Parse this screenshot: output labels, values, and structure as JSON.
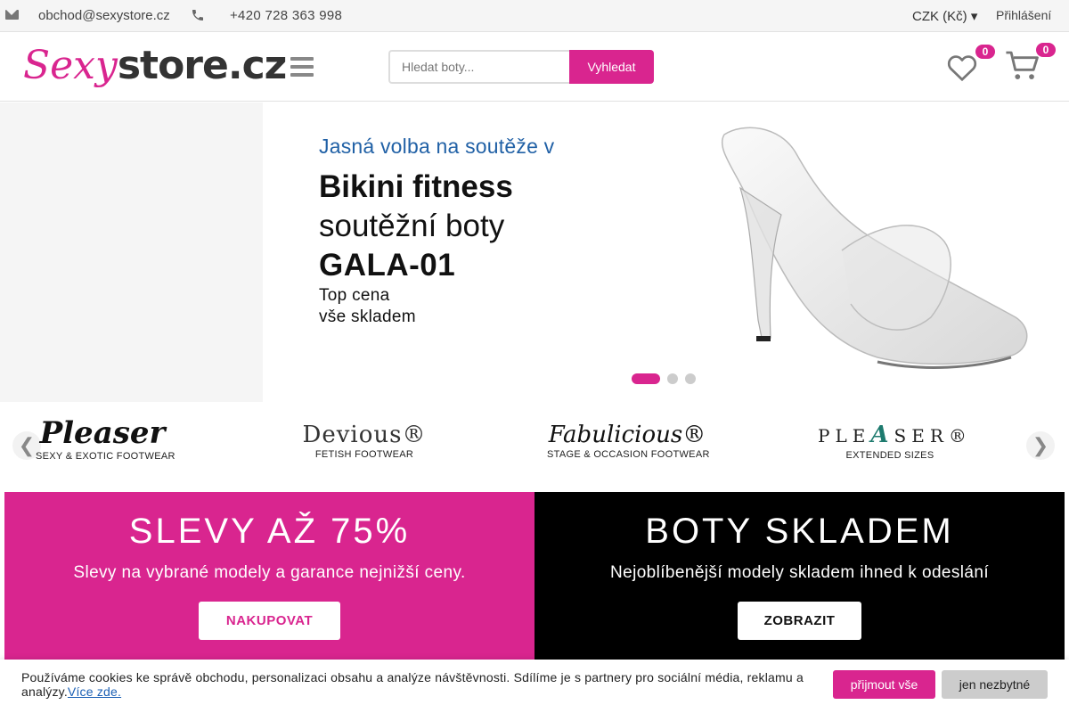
{
  "topbar": {
    "email": "obchod@sexystore.cz",
    "phone": "+420 728 363 998",
    "currency": "CZK (Kč) ▾",
    "login": " Přihlášení",
    "icons": {
      "email": "mail-icon",
      "phone": "phone-icon"
    }
  },
  "header": {
    "logo_part1": "Sexy",
    "logo_part2": "store.cz",
    "search_placeholder": "Hledat boty...",
    "search_button": "Vyhledat",
    "wishlist_count": "0",
    "cart_count": "0",
    "icons": {
      "menu": "hamburger-icon",
      "wishlist": "heart-icon",
      "cart": "cart-icon"
    }
  },
  "hero": {
    "kicker": "Jasná volba na soutěže v",
    "title": "Bikini fitness",
    "subtitle": "soutěžní boty",
    "model": "GALA-01",
    "price_line": "Top cena",
    "stock_line": "vše skladem",
    "slides": 3,
    "active_slide": 1
  },
  "brands": {
    "prev": "❮",
    "next": "❯",
    "items": [
      {
        "name": "Pleaser",
        "tagline": "SEXY & EXOTIC FOOTWEAR"
      },
      {
        "name": "Devious®",
        "tagline": "FETISH FOOTWEAR"
      },
      {
        "name": "Fabulicious®",
        "tagline": "STAGE & OCCASION FOOTWEAR"
      },
      {
        "name_a": "PLE",
        "name_b": "A",
        "name_c": "SER®",
        "tagline": "EXTENDED SIZES"
      }
    ]
  },
  "promos": {
    "sale": {
      "title": "SLEVY AŽ 75%",
      "text": "Slevy na vybrané modely a garance nejnižší ceny.",
      "button": "NAKUPOVAT"
    },
    "stock": {
      "title": "BOTY SKLADEM",
      "text": "Nejoblíbenější modely skladem ihned k odeslání",
      "button": "ZOBRAZIT"
    }
  },
  "cookie": {
    "text": "Používáme cookies ke správě obchodu, personalizaci obsahu a analýze návštěvnosti. Sdílíme je s partnery pro sociální média, reklamu a analýzy.",
    "more": "Více zde.",
    "accept": "přijmout vše",
    "essential": "jen nezbytné"
  },
  "colors": {
    "brand": "#d9258f",
    "kicker": "#2161a6",
    "dark": "#000000"
  }
}
